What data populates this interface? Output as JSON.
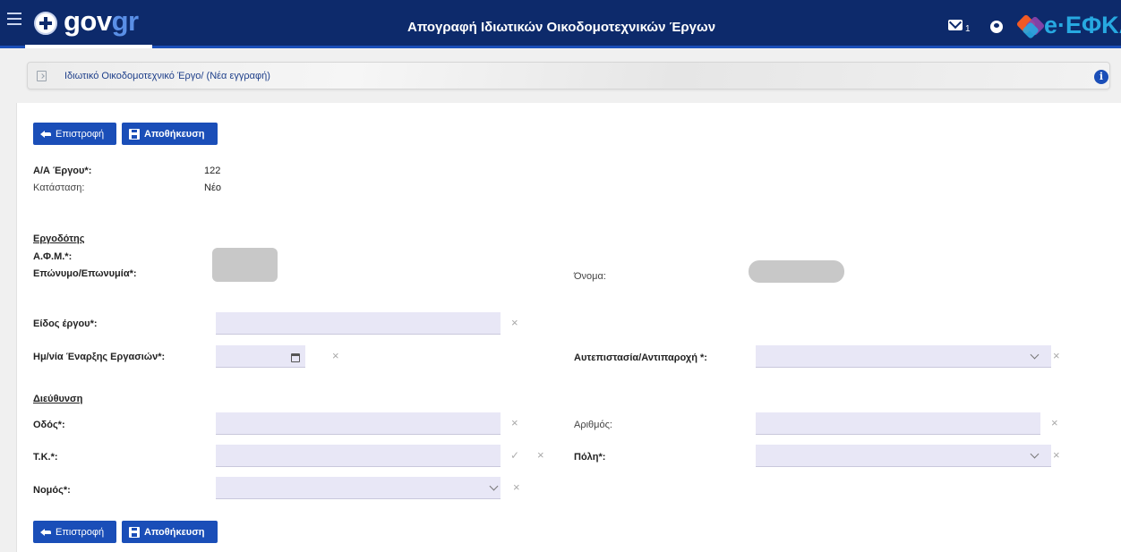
{
  "header": {
    "logo_main": "gov",
    "logo_accent": "gr",
    "title": "Απογραφή Ιδιωτικών Οικοδομοτεχνικών Έργων",
    "mail_count": "1",
    "efka_text": "e·ΕΦΚΑ"
  },
  "breadcrumb": {
    "text": "Ιδιωτικό Οικοδομοτεχνικό Έργο/ (Νέα εγγραφή)",
    "info_glyph": "i"
  },
  "buttons": {
    "back_label": "Επιστροφή",
    "save_label": "Αποθήκευση"
  },
  "project": {
    "aa_label": "Α/Α Έργου*:",
    "aa_value": "122",
    "status_label": "Κατάσταση:",
    "status_value": "Νέο"
  },
  "employer": {
    "section": "Εργοδότης",
    "afm_label": "Α.Φ.Μ.*:",
    "surname_label": "Επώνυμο/Επωνυμία*:",
    "name_label": "Όνομα:"
  },
  "work": {
    "type_label": "Είδος έργου*:",
    "start_date_label": "Ημ/νία Έναρξης Εργασιών*:",
    "self_build_label": "Αυτεπιστασία/Αντιπαροχή *:"
  },
  "address": {
    "section": "Διεύθυνση",
    "street_label": "Οδός*:",
    "number_label": "Αριθμός:",
    "postal_label": "Τ.Κ.*:",
    "city_label": "Πόλη*:",
    "prefecture_label": "Νομός*:"
  },
  "glyphs": {
    "clear": "×",
    "check": "✓"
  },
  "colors": {
    "header_bg": "#0d2a6b",
    "button_bg": "#1a4eb8",
    "input_bg": "#e8e7f6",
    "efka": "#27a9e1"
  }
}
